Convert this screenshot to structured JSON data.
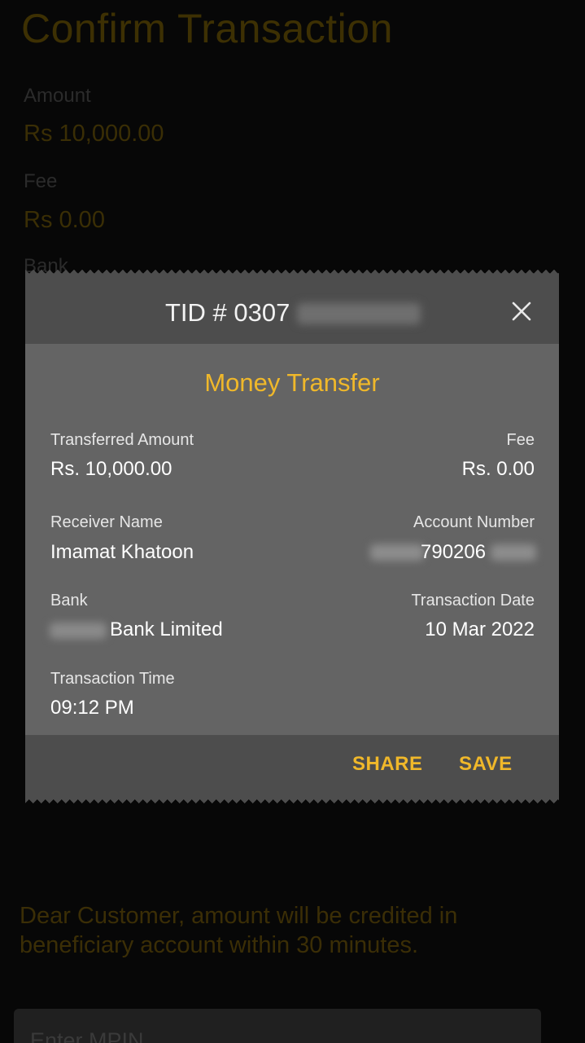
{
  "background": {
    "title": "Confirm Transaction",
    "amount_label": "Amount",
    "amount_value": "Rs 10,000.00",
    "fee_label": "Fee",
    "fee_value": "Rs 0.00",
    "bank_label": "Bank",
    "notice": "Dear Customer, amount will be credited in beneficiary account within 30 minutes.",
    "mpin_placeholder": "Enter MPIN"
  },
  "receipt": {
    "tid": "TID # 0307",
    "title": "Money Transfer",
    "transferred_amount_label": "Transferred Amount",
    "transferred_amount_value": "Rs. 10,000.00",
    "fee_label": "Fee",
    "fee_value": "Rs. 0.00",
    "receiver_name_label": "Receiver Name",
    "receiver_name_value": "Imamat Khatoon",
    "account_number_label": "Account Number",
    "account_number_value": "790206",
    "bank_label": "Bank",
    "bank_value": "Bank Limited",
    "transaction_date_label": "Transaction Date",
    "transaction_date_value": "10 Mar 2022",
    "transaction_time_label": "Transaction Time",
    "transaction_time_value": "09:12 PM",
    "share_label": "SHARE",
    "save_label": "SAVE"
  },
  "colors": {
    "accent": "#f0b82a",
    "dialog_header": "#4d4d4d",
    "dialog_body": "#646464"
  },
  "icons": {
    "close": "close-icon"
  }
}
